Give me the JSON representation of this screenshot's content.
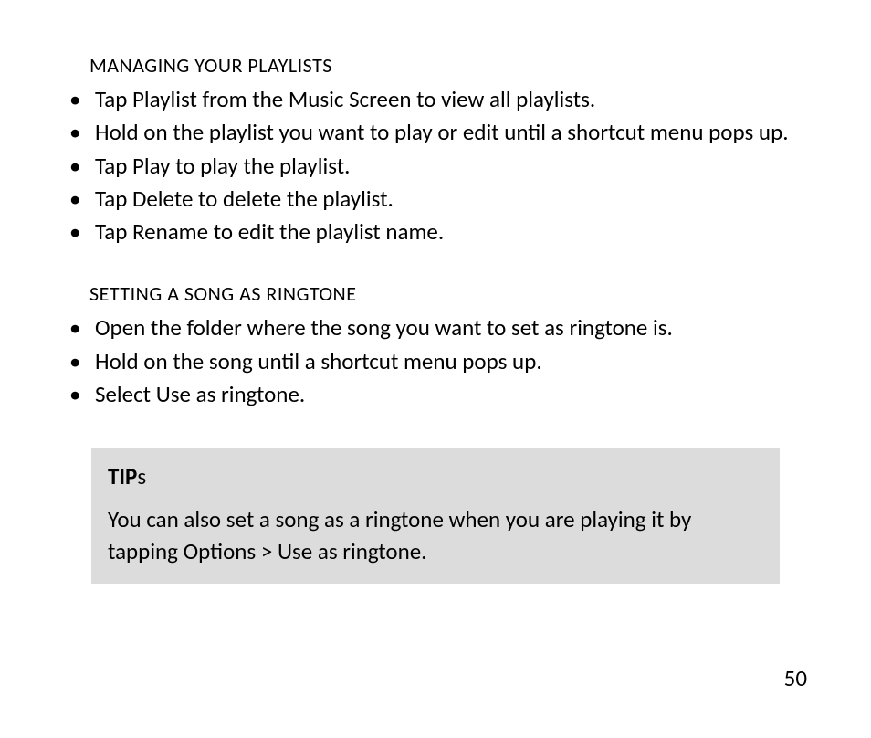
{
  "sections": [
    {
      "heading": "MANAGING YOUR PLAYLISTS",
      "bullets": [
        "Tap Playlist from the Music Screen to view all playlists.",
        "Hold on the playlist you want to play or edit until a shortcut menu pops up.",
        "Tap Play to play the playlist.",
        "Tap Delete to delete the playlist.",
        "Tap Rename to edit the playlist name."
      ]
    },
    {
      "heading": "SETTING A SONG AS RINGTONE",
      "bullets": [
        "Open the folder where the song you want to set as ringtone is.",
        "Hold on the song until a shortcut menu pops up.",
        "Select Use as ringtone."
      ]
    }
  ],
  "tip": {
    "title_bold": "TIP",
    "title_rest": "s",
    "body": "You can also set a song as a ringtone when you are playing it by tapping Options > Use as ringtone."
  },
  "page_number": "50"
}
